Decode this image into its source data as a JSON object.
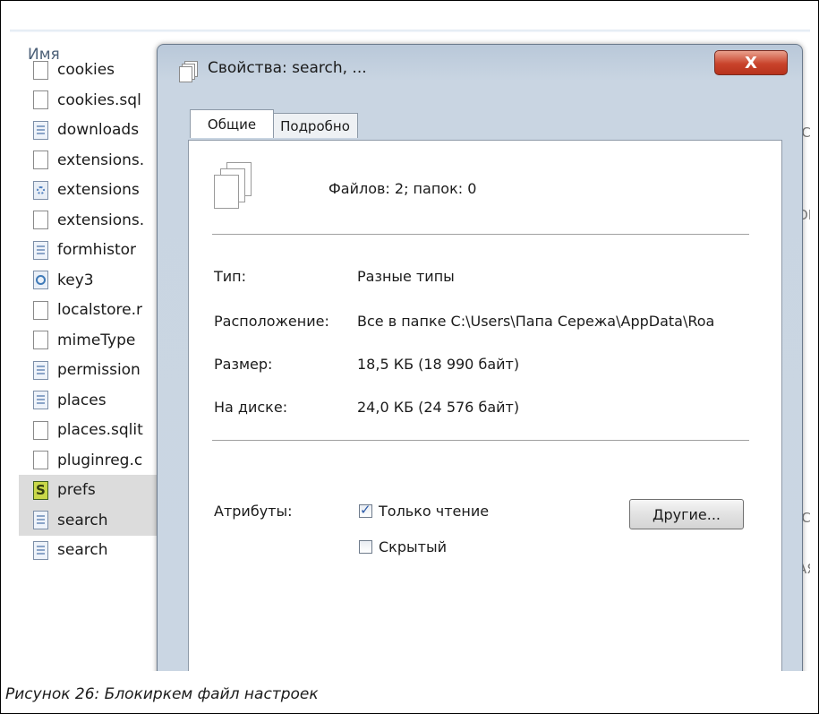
{
  "explorer": {
    "column_header": "Имя",
    "files": [
      {
        "name": "cookies",
        "icon": "blank-file-icon",
        "type": "blank",
        "selected": false
      },
      {
        "name": "cookies.sql",
        "icon": "blank-file-icon",
        "type": "blank",
        "selected": false
      },
      {
        "name": "downloads",
        "icon": "document-file-icon",
        "type": "doc",
        "selected": false
      },
      {
        "name": "extensions.",
        "icon": "blank-file-icon",
        "type": "blank",
        "selected": false
      },
      {
        "name": "extensions",
        "icon": "settings-file-icon",
        "type": "gear",
        "selected": false
      },
      {
        "name": "extensions.",
        "icon": "blank-file-icon",
        "type": "blank",
        "selected": false
      },
      {
        "name": "formhistor",
        "icon": "document-file-icon",
        "type": "doc",
        "selected": false
      },
      {
        "name": "key3",
        "icon": "key-file-icon",
        "type": "key",
        "selected": false
      },
      {
        "name": "localstore.r",
        "icon": "blank-file-icon",
        "type": "blank",
        "selected": false
      },
      {
        "name": "mimeType",
        "icon": "blank-file-icon",
        "type": "blank",
        "selected": false
      },
      {
        "name": "permission",
        "icon": "document-file-icon",
        "type": "doc",
        "selected": false
      },
      {
        "name": "places",
        "icon": "document-file-icon",
        "type": "doc",
        "selected": false
      },
      {
        "name": "places.sqlit",
        "icon": "blank-file-icon",
        "type": "blank",
        "selected": false
      },
      {
        "name": "pluginreg.c",
        "icon": "blank-file-icon",
        "type": "blank",
        "selected": false
      },
      {
        "name": "prefs",
        "icon": "script-file-icon",
        "type": "script",
        "selected": true
      },
      {
        "name": "search",
        "icon": "document-file-icon",
        "type": "doc",
        "selected": true
      },
      {
        "name": "search",
        "icon": "document-file-icon",
        "type": "doc",
        "selected": false
      }
    ],
    "edge_fragments": [
      "-JC",
      "-",
      "-",
      "ОН",
      "-",
      "-",
      "-",
      "-",
      "-",
      "-",
      "-",
      "-JC",
      "-",
      "АЯ",
      "-",
      "-"
    ]
  },
  "dialog": {
    "title": "Свойства: search, ...",
    "close_label": "X",
    "tabs": [
      {
        "label": "Общие",
        "active": true
      },
      {
        "label": "Подробно",
        "active": false
      }
    ],
    "summary": "Файлов: 2; папок: 0",
    "properties": [
      {
        "label": "Тип:",
        "value": "Разные типы"
      },
      {
        "label": "Расположение:",
        "value": "Все в папке C:\\Users\\Папа Сережа\\AppData\\Roa"
      },
      {
        "label": "Размер:",
        "value": "18,5 КБ (18 990 байт)"
      },
      {
        "label": "На диске:",
        "value": "24,0 КБ (24 576 байт)"
      }
    ],
    "attributes_label": "Атрибуты:",
    "readonly_label": "Только чтение",
    "readonly_checked": true,
    "hidden_label": "Скрытый",
    "hidden_checked": false,
    "other_button": "Другие..."
  },
  "caption": "Рисунок 26: Блокиркем файл настроек"
}
